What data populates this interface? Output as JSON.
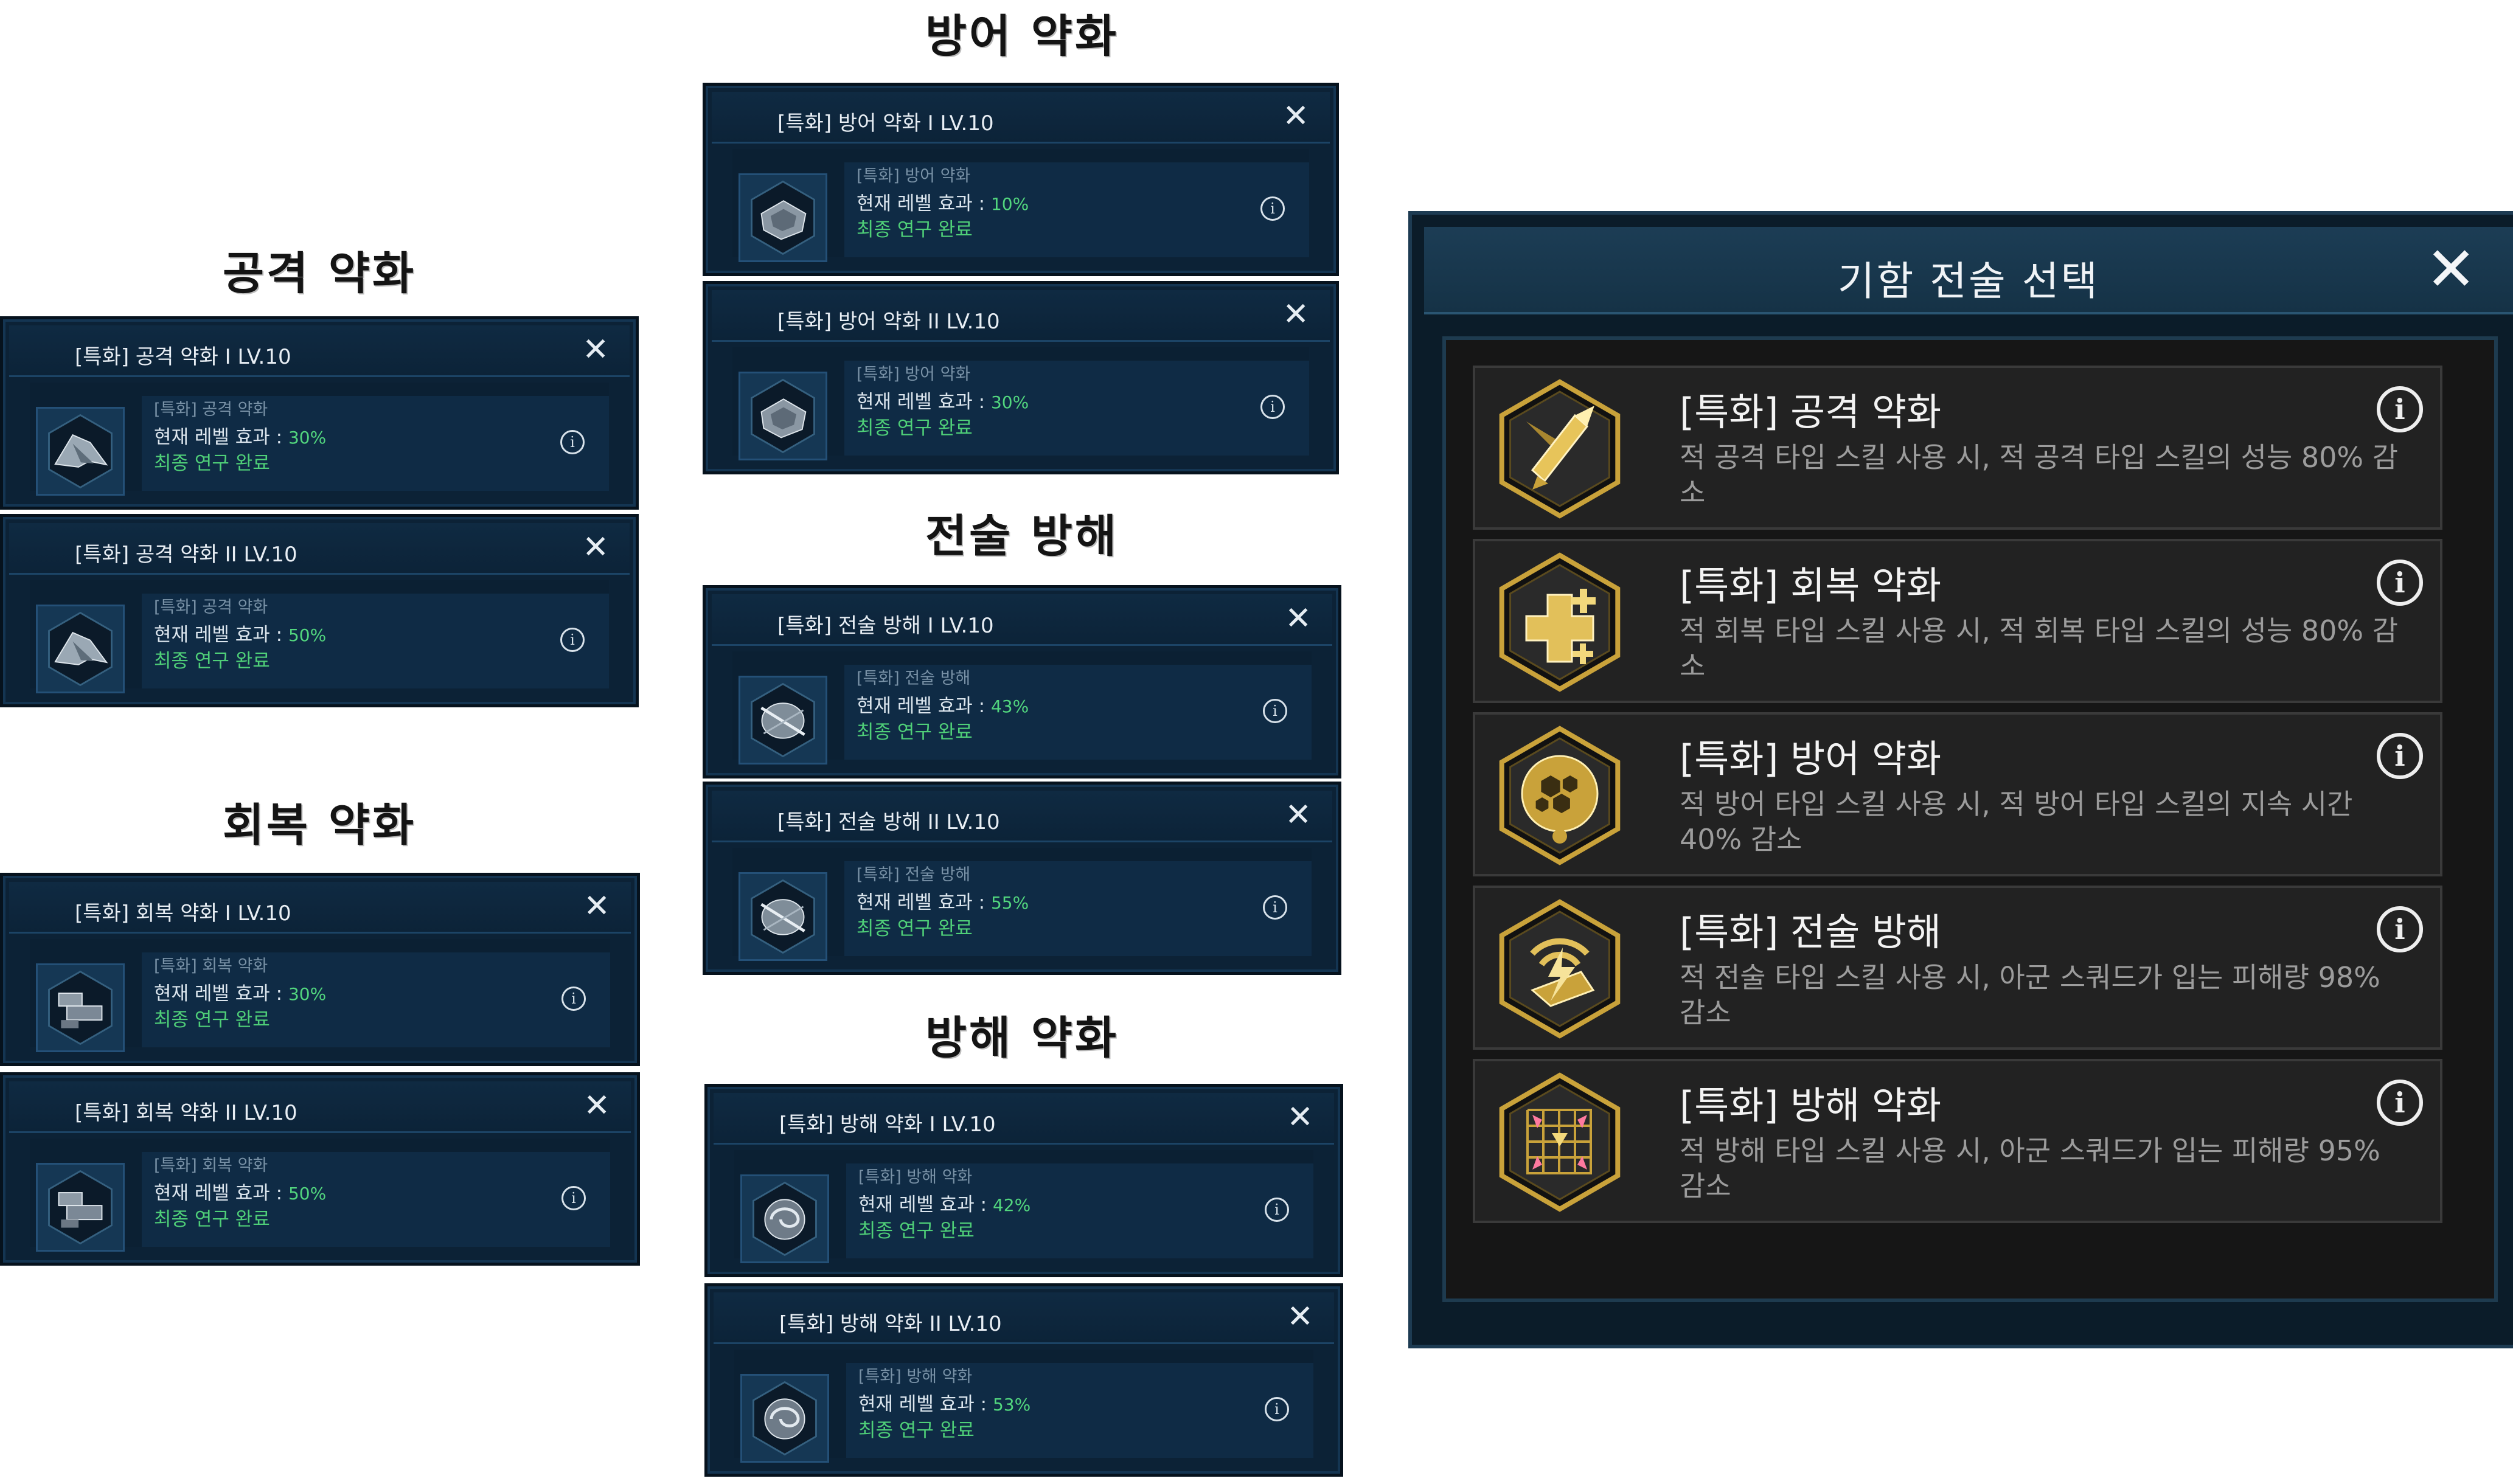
{
  "headings": {
    "attack": "공격 약화",
    "recovery": "회복 약화",
    "defense": "방어 약화",
    "tactic": "전술 방해",
    "disrupt": "방해 약화"
  },
  "cards": {
    "attack_1": {
      "title": "[특화] 공격 약화 I LV.10",
      "subtitle": "[특화] 공격 약화",
      "effect_label": "현재 레벨 효과 : ",
      "effect_value": "30%",
      "status": "최종 연구 완료",
      "icon": "fighter-ship-icon"
    },
    "attack_2": {
      "title": "[특화] 공격 약화 II LV.10",
      "subtitle": "[특화] 공격 약화",
      "effect_label": "현재 레벨 효과 : ",
      "effect_value": "50%",
      "status": "최종 연구 완료",
      "icon": "fighter-ship-icon"
    },
    "recovery_1": {
      "title": "[특화] 회복 약화 I LV.10",
      "subtitle": "[특화] 회복 약화",
      "effect_label": "현재 레벨 효과 : ",
      "effect_value": "30%",
      "status": "최종 연구 완료",
      "icon": "repair-ship-icon"
    },
    "recovery_2": {
      "title": "[특화] 회복 약화 II LV.10",
      "subtitle": "[특화] 회복 약화",
      "effect_label": "현재 레벨 효과 : ",
      "effect_value": "50%",
      "status": "최종 연구 완료",
      "icon": "repair-ship-icon"
    },
    "defense_1": {
      "title": "[특화] 방어 약화 I LV.10",
      "subtitle": "[특화] 방어 약화",
      "effect_label": "현재 레벨 효과 : ",
      "effect_value": "10%",
      "status": "최종 연구 완료",
      "icon": "armor-ship-icon"
    },
    "defense_2": {
      "title": "[특화] 방어 약화 II LV.10",
      "subtitle": "[특화] 방어 약화",
      "effect_label": "현재 레벨 효과 : ",
      "effect_value": "30%",
      "status": "최종 연구 완료",
      "icon": "armor-ship-icon"
    },
    "tactic_1": {
      "title": "[특화] 전술 방해 I LV.10",
      "subtitle": "[특화] 전술 방해",
      "effect_label": "현재 레벨 효과 : ",
      "effect_value": "43%",
      "status": "최종 연구 완료",
      "icon": "jammer-ship-icon"
    },
    "tactic_2": {
      "title": "[특화] 전술 방해 II LV.10",
      "subtitle": "[특화] 전술 방해",
      "effect_label": "현재 레벨 효과 : ",
      "effect_value": "55%",
      "status": "최종 연구 완료",
      "icon": "jammer-ship-icon"
    },
    "disrupt_1": {
      "title": "[특화] 방해 약화 I LV.10",
      "subtitle": "[특화] 방해 약화",
      "effect_label": "현재 레벨 효과 : ",
      "effect_value": "42%",
      "status": "최종 연구 완료",
      "icon": "vortex-icon"
    },
    "disrupt_2": {
      "title": "[특화] 방해 약화 II LV.10",
      "subtitle": "[특화] 방해 약화",
      "effect_label": "현재 레벨 효과 : ",
      "effect_value": "53%",
      "status": "최종 연구 완료",
      "icon": "vortex-icon"
    }
  },
  "dialog": {
    "title": "기함 전술 선택",
    "items": [
      {
        "name": "[특화] 공격 약화",
        "desc": "적 공격 타입 스킬 사용 시, 적 공격 타입 스킬의 성능 80% 감소",
        "icon": "missile-icon"
      },
      {
        "name": "[특화] 회복 약화",
        "desc": "적 회복 타입 스킬 사용 시, 적 회복 타입 스킬의 성능 80% 감소",
        "icon": "heal-cross-icon"
      },
      {
        "name": "[특화] 방어 약화",
        "desc": "적 방어 타입 스킬 사용 시, 적 방어 타입 스킬의 지속 시간 40% 감소",
        "icon": "shield-sphere-icon"
      },
      {
        "name": "[특화] 전술 방해",
        "desc": "적 전술 타입 스킬 사용 시, 아군 스쿼드가 입는 피해량 98% 감소",
        "icon": "signal-jam-icon"
      },
      {
        "name": "[특화] 방해 약화",
        "desc": "적 방해 타입 스킬 사용 시, 아군 스쿼드가 입는 피해량 95% 감소",
        "icon": "grid-target-icon"
      }
    ]
  },
  "colors": {
    "card_bg": "#0c2236",
    "highlight_green": "#52d67e",
    "gold": "#c9a23a",
    "dialog_bg": "#0b1c29"
  }
}
